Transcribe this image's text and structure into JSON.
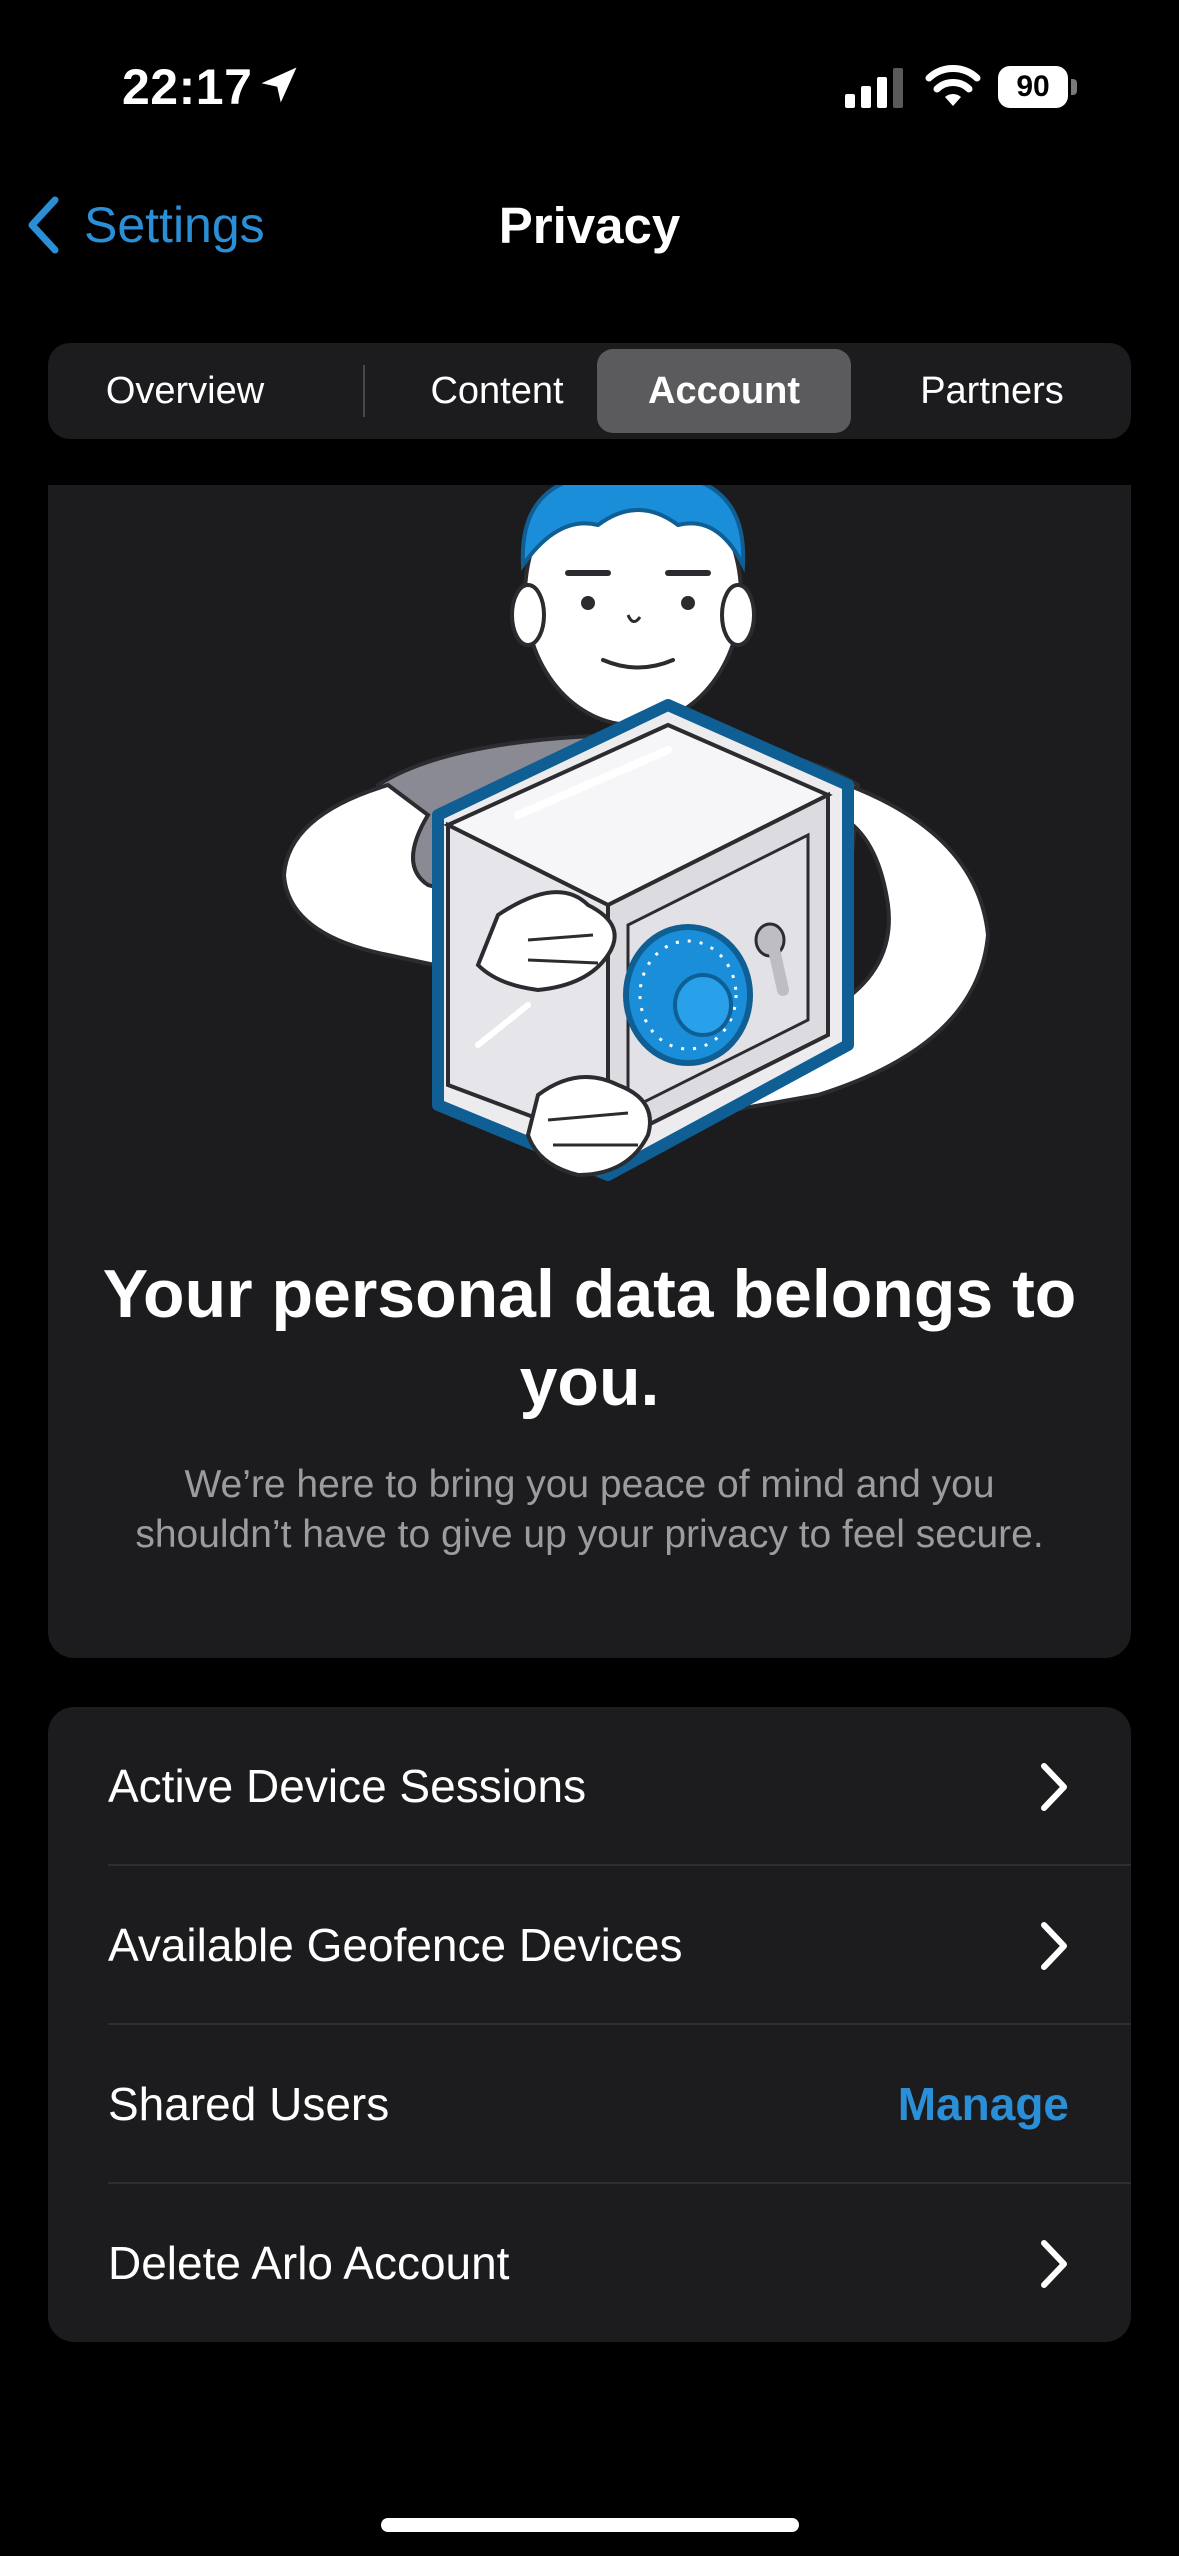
{
  "status_bar": {
    "time": "22:17",
    "battery": "90",
    "icons": [
      "location-arrow-icon",
      "cellular-signal-icon",
      "wifi-icon",
      "battery-icon"
    ]
  },
  "nav": {
    "back_label": "Settings",
    "title": "Privacy"
  },
  "tabs": [
    {
      "label": "Overview",
      "active": false
    },
    {
      "label": "Content",
      "active": false
    },
    {
      "label": "Account",
      "active": true
    },
    {
      "label": "Partners",
      "active": false
    }
  ],
  "hero": {
    "title": "Your personal data belongs to you.",
    "subtitle": "We’re here to bring you peace of mind and you shouldn’t have to give up your privacy to feel secure."
  },
  "rows": [
    {
      "label": "Active Device Sessions",
      "accessory": "chevron"
    },
    {
      "label": "Available Geofence Devices",
      "accessory": "chevron"
    },
    {
      "label": "Shared Users",
      "accessory": "action",
      "action_label": "Manage"
    },
    {
      "label": "Delete Arlo Account",
      "accessory": "chevron"
    }
  ],
  "colors": {
    "accent": "#2a8fd6",
    "background": "#000000",
    "card": "#1c1c1e",
    "illustration_blue": "#1a8ed8"
  }
}
